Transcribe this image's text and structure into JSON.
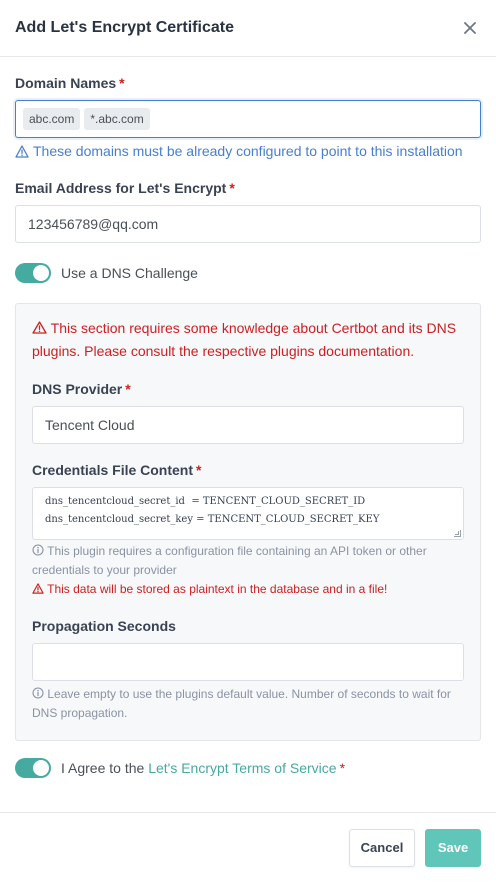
{
  "modal": {
    "title": "Add Let's Encrypt Certificate",
    "close_icon": "close-icon"
  },
  "domain": {
    "label": "Domain Names",
    "required": "*",
    "tags": [
      "abc.com",
      "*.abc.com"
    ],
    "hint": "These domains must be already configured to point to this installation"
  },
  "email": {
    "label": "Email Address for Let's Encrypt",
    "required": "*",
    "value": "123456789@qq.com"
  },
  "dns_challenge": {
    "label": "Use a DNS Challenge",
    "enabled": true
  },
  "dns_section": {
    "warning": "This section requires some knowledge about Certbot and its DNS plugins. Please consult the respective plugins documentation.",
    "provider": {
      "label": "DNS Provider",
      "required": "*",
      "value": "Tencent Cloud"
    },
    "credentials": {
      "label": "Credentials File Content",
      "required": "*",
      "lines": [
        "dns_tencentcloud_secret_id  = TENCENT_CLOUD_SECRET_ID",
        "dns_tencentcloud_secret_key = TENCENT_CLOUD_SECRET_KEY"
      ],
      "help": "This plugin requires a configuration file containing an API token or other credentials to your provider",
      "warning": "This data will be stored as plaintext in the database and in a file!"
    },
    "propagation": {
      "label": "Propagation Seconds",
      "value": "",
      "help": "Leave empty to use the plugins default value. Number of seconds to wait for DNS propagation."
    }
  },
  "agree": {
    "prefix": "I Agree to the",
    "link": "Let's Encrypt Terms of Service",
    "required": "*",
    "enabled": true
  },
  "footer": {
    "cancel": "Cancel",
    "save": "Save"
  },
  "colors": {
    "accent": "#45aaa0",
    "save_button": "#5fc6b9",
    "danger": "#cd201f",
    "info": "#467fcf"
  }
}
